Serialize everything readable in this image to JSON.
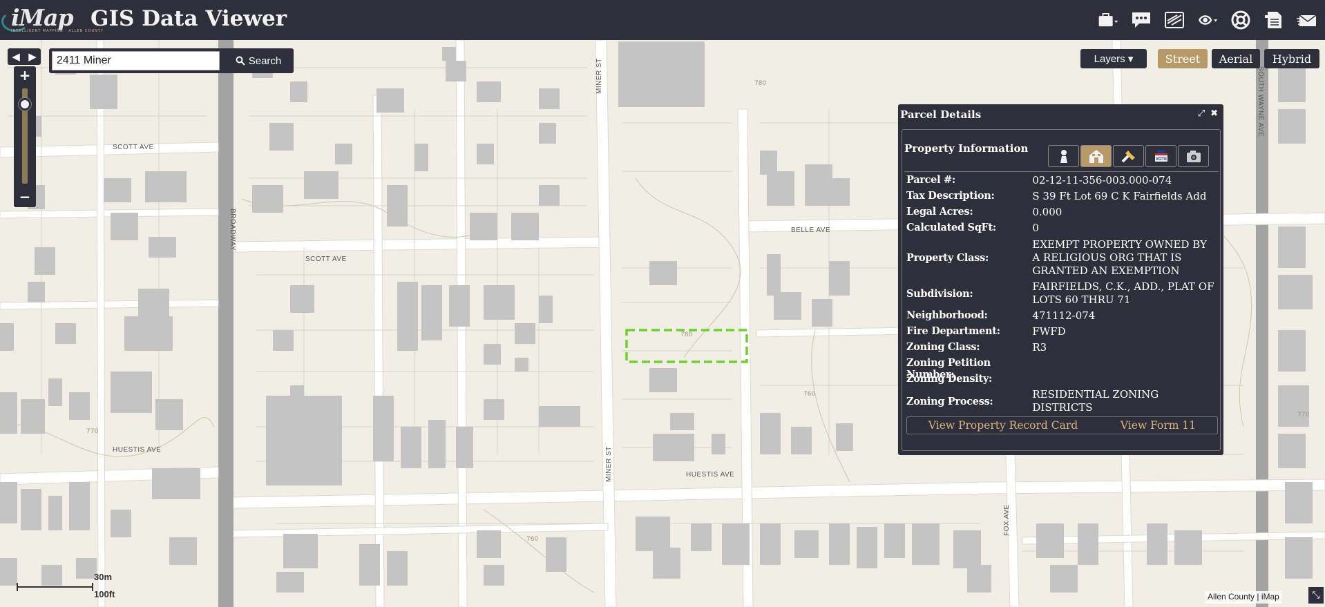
{
  "header": {
    "logo_text": "iMap",
    "logo_sub": "INTELLIGENT MAPPING · ALLEN COUNTY",
    "title": "GIS Data Viewer",
    "icons": [
      "briefcase-icon",
      "comment-icon",
      "map-print-icon",
      "share-icon",
      "help-icon",
      "document-icon",
      "mail-icon"
    ]
  },
  "nav": {
    "back": "◀",
    "forward": "▶"
  },
  "search": {
    "value": "2411 Miner",
    "button_label": "Search"
  },
  "zoom": {
    "in_label": "+",
    "out_label": "−"
  },
  "layers": {
    "label": "Layers ▾"
  },
  "basemaps": [
    {
      "label": "Street",
      "active": true
    },
    {
      "label": "Aerial",
      "active": false
    },
    {
      "label": "Hybrid",
      "active": false
    }
  ],
  "streets": {
    "scott_ave_1": "SCOTT AVE",
    "scott_ave_2": "SCOTT AVE",
    "broadway": "BROADWAY",
    "miner_st_1": "MINER ST",
    "miner_st_2": "MINER ST",
    "belle_ave": "BELLE AVE",
    "huestis_ave_1": "HUESTIS AVE",
    "huestis_ave_2": "HUESTIS AVE",
    "fox_ave": "FOX AVE",
    "south_wayne_ave": "SOUTH WAYNE AVE"
  },
  "contours": {
    "c1": "770",
    "c2": "780",
    "c3": "760",
    "c4": "760",
    "c5": "770",
    "c6": "780"
  },
  "panel": {
    "title": "Parcel Details",
    "section_title": "Property Information",
    "tabs": [
      "owner-icon",
      "property-icon",
      "permits-icon",
      "vote-icon",
      "camera-icon"
    ],
    "tab_vote_label": "VOTE",
    "rows": [
      {
        "label": "Parcel #:",
        "value": "02-12-11-356-003.000-074"
      },
      {
        "label": "Tax Description:",
        "value": "S 39 Ft Lot 69 C K Fairfields Add"
      },
      {
        "label": "Legal Acres:",
        "value": "0.000"
      },
      {
        "label": "Calculated SqFt:",
        "value": "0"
      },
      {
        "label": "Property Class:",
        "value": "EXEMPT PROPERTY OWNED BY A RELIGIOUS ORG THAT IS GRANTED AN EXEMPTION"
      },
      {
        "label": "Subdivision:",
        "value": "FAIRFIELDS, C.K., ADD., PLAT OF LOTS 60 THRU 71"
      },
      {
        "label": "Neighborhood:",
        "value": "471112-074"
      },
      {
        "label": "Fire Department:",
        "value": "FWFD"
      },
      {
        "label": "Zoning Class:",
        "value": "R3"
      },
      {
        "label": "Zoning Petition Number:",
        "value": ""
      },
      {
        "label": "Zoning Density:",
        "value": ""
      },
      {
        "label": "Zoning Process:",
        "value": "RESIDENTIAL ZONING DISTRICTS"
      }
    ],
    "link_record_card": "View Property Record Card",
    "link_form11": "View Form 11"
  },
  "scale": {
    "metric": "30m",
    "imperial": "100ft"
  },
  "attribution": "Allen County | iMap",
  "colors": {
    "header": "#2f2f3b",
    "accent": "#b89a68",
    "link": "#d6b47a",
    "selection": "#6cd12b",
    "building": "#c4c4c4",
    "road": "#ffffff",
    "highway": "#a3a3a3"
  }
}
